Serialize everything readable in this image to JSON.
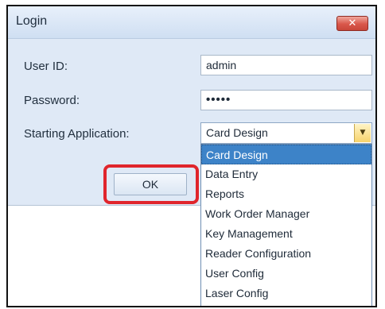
{
  "dialog": {
    "title": "Login",
    "close_label": "✕"
  },
  "form": {
    "user_id_label": "User ID:",
    "user_id_value": "admin",
    "password_label": "Password:",
    "password_value": "•••••",
    "starting_app_label": "Starting Application:",
    "starting_app_value": "Card Design",
    "dropdown_arrow": "▼"
  },
  "buttons": {
    "ok_label": "OK"
  },
  "dropdown": {
    "items": [
      {
        "label": "Card Design",
        "selected": true
      },
      {
        "label": "Data Entry",
        "selected": false
      },
      {
        "label": "Reports",
        "selected": false
      },
      {
        "label": "Work Order Manager",
        "selected": false
      },
      {
        "label": "Key Management",
        "selected": false
      },
      {
        "label": "Reader Configuration",
        "selected": false
      },
      {
        "label": "User Config",
        "selected": false
      },
      {
        "label": "Laser Config",
        "selected": false
      }
    ]
  },
  "colors": {
    "highlight": "#e0252c",
    "selection": "#3d83c8",
    "dialog_bg": "#dfe9f6"
  }
}
